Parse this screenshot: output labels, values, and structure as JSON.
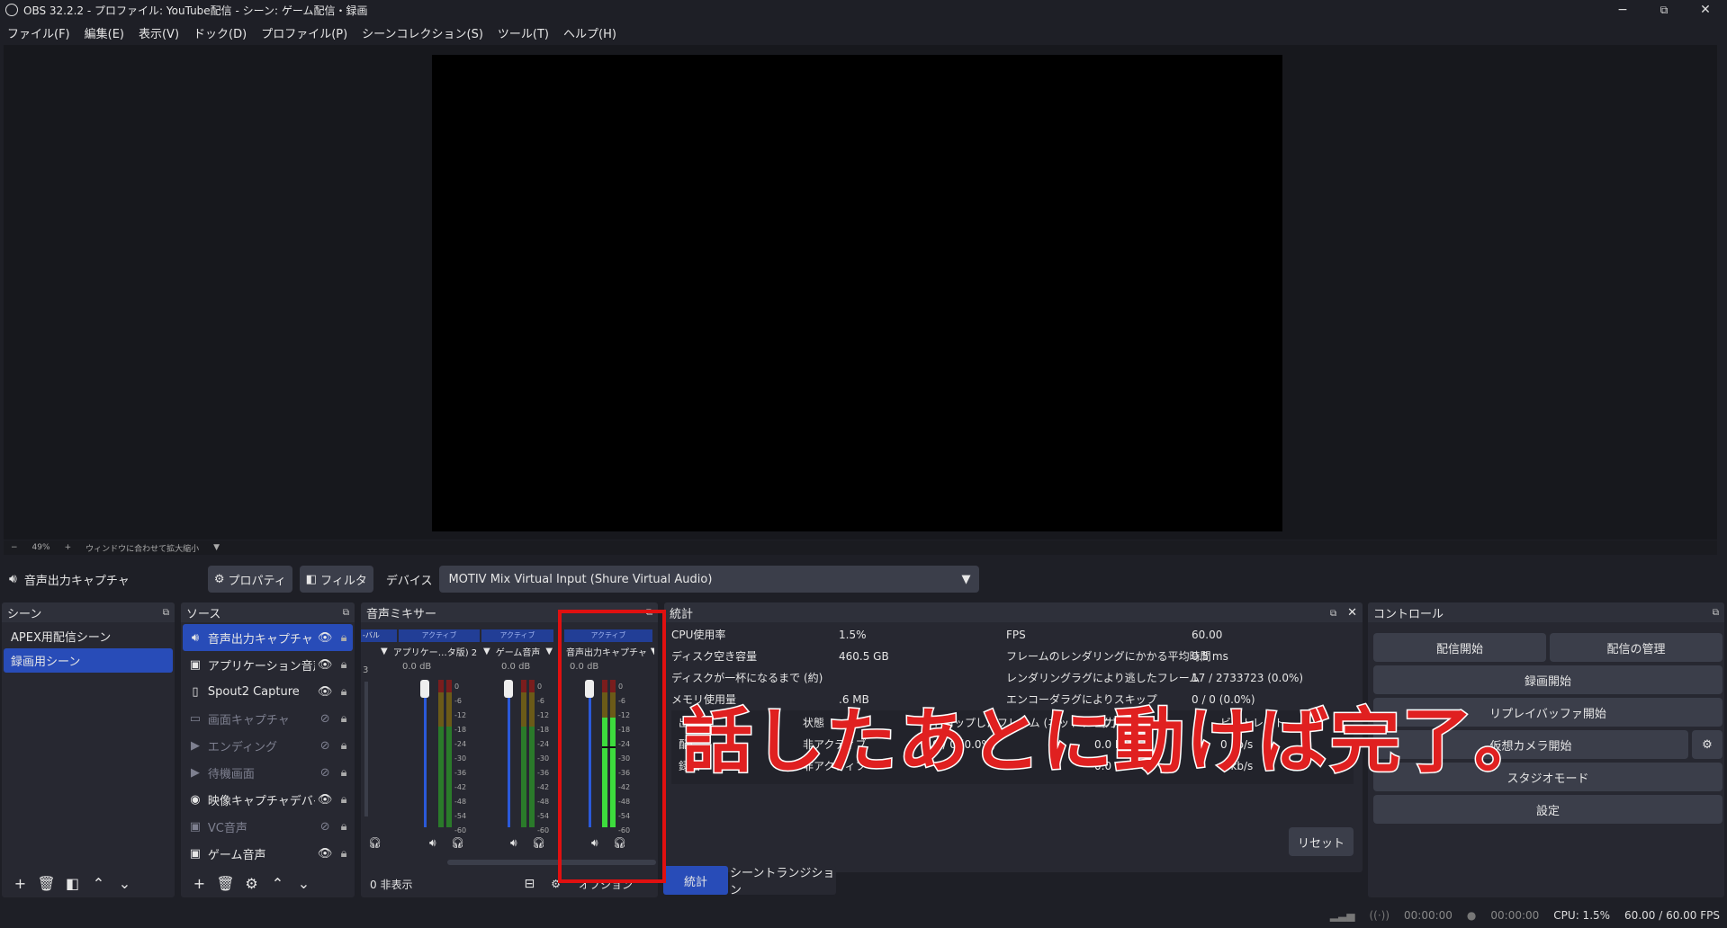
{
  "titlebar": {
    "title": "OBS 32.2.2 - プロファイル: YouTube配信 - シーン: ゲーム配信・録画",
    "minimize": "−",
    "maximize": "⧉",
    "close": "✕"
  },
  "menu": [
    "ファイル(F)",
    "編集(E)",
    "表示(V)",
    "ドック(D)",
    "プロファイル(P)",
    "シーンコレクション(S)",
    "ツール(T)",
    "ヘルプ(H)"
  ],
  "zoom": {
    "minus": "−",
    "level": "49%",
    "plus": "+",
    "fit_label": "ウィンドウに合わせて拡大縮小"
  },
  "source_bar": {
    "name": "音声出力キャプチャ",
    "properties": "プロパティ",
    "filters": "フィルタ",
    "device_label": "デバイス",
    "device_value": "MOTIV Mix Virtual Input (Shure Virtual Audio)"
  },
  "scenes": {
    "title": "シーン",
    "items": [
      "APEX用配信シーン",
      "録画用シーン"
    ],
    "selected": 1
  },
  "sources": {
    "title": "ソース",
    "items": [
      {
        "label": "音声出力キャプチャ",
        "icon": "speaker-icon",
        "visible": true
      },
      {
        "label": "アプリケーション音声",
        "icon": "app-audio-icon",
        "visible": true
      },
      {
        "label": "Spout2 Capture",
        "icon": "file-icon",
        "visible": true
      },
      {
        "label": "画面キャプチャ",
        "icon": "monitor-icon",
        "visible": false
      },
      {
        "label": "エンディング",
        "icon": "play-icon",
        "visible": false
      },
      {
        "label": "待機画面",
        "icon": "play-icon",
        "visible": false
      },
      {
        "label": "映像キャプチャデバイス",
        "icon": "camera-icon",
        "visible": true
      },
      {
        "label": "VC音声",
        "icon": "app-audio-icon",
        "visible": false
      },
      {
        "label": "ゲーム音声",
        "icon": "app-audio-icon",
        "visible": true
      }
    ]
  },
  "mixer": {
    "title": "音声ミキサー",
    "hidden_count": "0 非表示",
    "options": "オプション",
    "channels": [
      {
        "name": "アプリケー…タ版) 2",
        "status": "アクティブ",
        "db": "0.0 dB"
      },
      {
        "name": "ゲーム音声",
        "status": "アクティブ",
        "db": "0.0 dB"
      },
      {
        "name": "音声出力キャプチャ",
        "status": "アクティブ",
        "db": "0.0 dB"
      }
    ],
    "partial_label": "-バル",
    "partial_num": "3",
    "scale": [
      "0",
      "-6",
      "-12",
      "-18",
      "-24",
      "-30",
      "-36",
      "-42",
      "-48",
      "-54",
      "-60"
    ]
  },
  "stats": {
    "title": "統計",
    "left": [
      [
        "CPU使用率",
        "1.5%"
      ],
      [
        "ディスク空き容量",
        "460.5 GB"
      ],
      [
        "ディスクが一杯になるまで (約)",
        ""
      ],
      [
        "メモリ使用量",
        ".6 MB"
      ]
    ],
    "right": [
      [
        "FPS",
        "60.00"
      ],
      [
        "フレームのレンダリングにかかる平均時間",
        "0.5 ms"
      ],
      [
        "レンダリングラグにより逃したフレーム",
        "17 / 2733723 (0.0%)"
      ],
      [
        "エンコーダラグによりスキップ",
        "0 / 0 (0.0%)"
      ]
    ],
    "table_headers": [
      "出力",
      "状態",
      "ドロップしたフレーム (ネットワーク)",
      "出力データ",
      "ビットレート"
    ],
    "rows": [
      [
        "配信",
        "非アクティブ",
        "0 / 0 (0.0%)",
        "0.0 MiB",
        "0 kb/s"
      ],
      [
        "録画",
        "非アクティブ",
        "",
        "0.0 MiB",
        "0 kb/s"
      ]
    ],
    "reset": "リセット"
  },
  "tabs": [
    "統計",
    "シーントランジション"
  ],
  "controls": {
    "title": "コントロール",
    "start_stream": "配信開始",
    "manage_stream": "配信の管理",
    "start_record": "録画開始",
    "replay_buffer": "リプレイバッファ開始",
    "virtual_cam": "仮想カメラ開始",
    "studio_mode": "スタジオモード",
    "settings": "設定"
  },
  "status": {
    "stream_time": "00:00:00",
    "rec_time": "00:00:00",
    "cpu": "CPU: 1.5%",
    "fps": "60.00 / 60.00 FPS"
  },
  "overlay_caption": "話したあとに動けば完了。",
  "colors": {
    "accent": "#284cb8",
    "annotation": "#e02020"
  }
}
